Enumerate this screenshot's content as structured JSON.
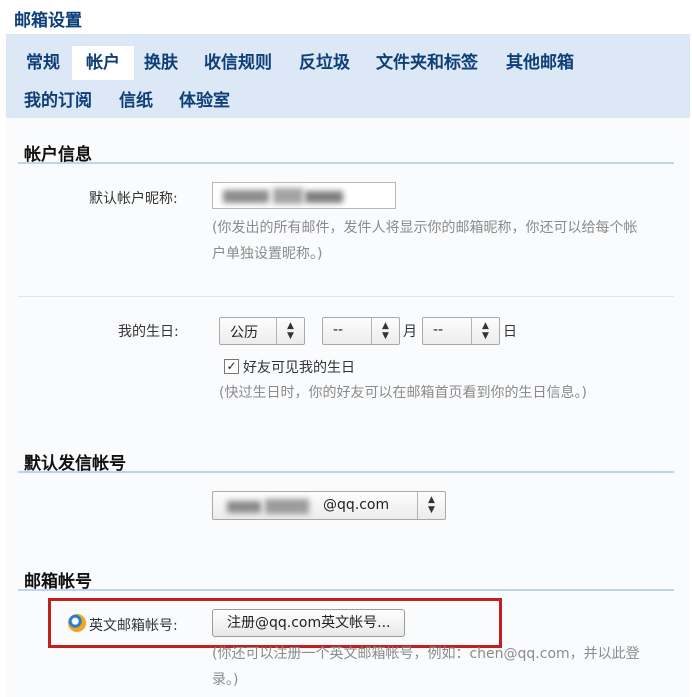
{
  "page": {
    "title": "邮箱设置"
  },
  "tabs": [
    {
      "label": "常规",
      "active": false
    },
    {
      "label": "帐户",
      "active": true
    },
    {
      "label": "换肤",
      "active": false
    },
    {
      "label": "收信规则",
      "active": false
    },
    {
      "label": "反垃圾",
      "active": false
    },
    {
      "label": "文件夹和标签",
      "active": false
    },
    {
      "label": "其他邮箱",
      "active": false
    },
    {
      "label": "我的订阅",
      "active": false
    },
    {
      "label": "信纸",
      "active": false
    },
    {
      "label": "体验室",
      "active": false
    }
  ],
  "account_info": {
    "title": "帐户信息",
    "nickname_label": "默认帐户昵称:",
    "nickname_hint_line1": "(你发出的所有邮件，发件人将显示你的邮箱昵称，你还可以给每个帐",
    "nickname_hint_line2": "户单独设置昵称。)",
    "birthday_label": "我的生日:",
    "calendar_select": "公历",
    "month_select": "--",
    "month_unit": "月",
    "day_select": "--",
    "day_unit": "日",
    "friends_visible_label": "好友可见我的生日",
    "friends_visible_checked": true,
    "birthday_hint": "(快过生日时，你的好友可以在邮箱首页看到你的生日信息。)"
  },
  "default_sender": {
    "title": "默认发信帐号",
    "select_suffix": "@qq.com"
  },
  "mailbox_account": {
    "title": "邮箱帐号",
    "english_label": "英文邮箱帐号:",
    "register_button": "注册@qq.com英文帐号...",
    "hint_line1": "(你还可以注册一个英文邮箱帐号，例如：chen@qq.com，并以此登",
    "hint_line2": "录。)"
  },
  "icons": {
    "arrows": "up-down-arrows-icon",
    "check": "check-icon",
    "qq": "qq-logo-icon"
  },
  "colors": {
    "tab_bar": "#dce8f6",
    "highlight_border": "#c0211d",
    "section_line": "#bcd5ec"
  }
}
